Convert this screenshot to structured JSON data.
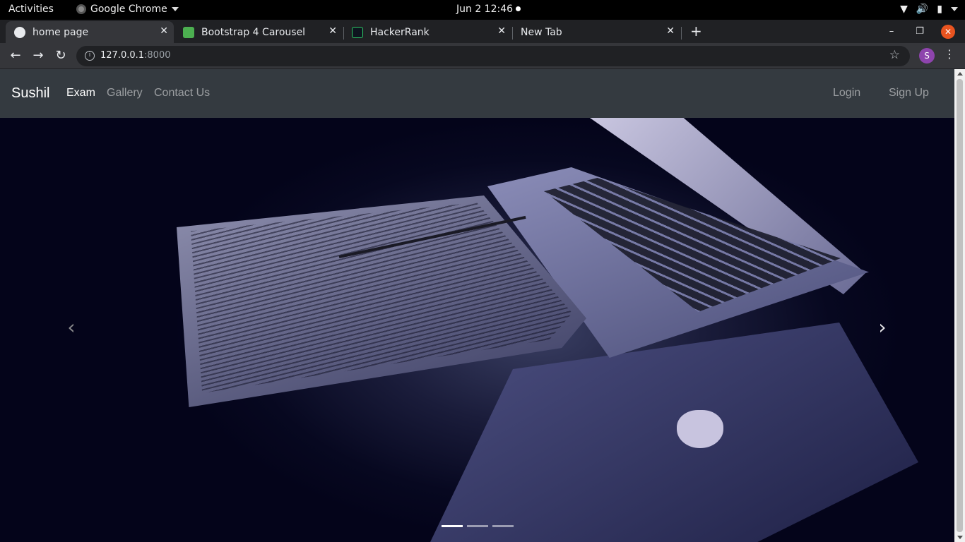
{
  "system_bar": {
    "activities": "Activities",
    "app_name": "Google Chrome",
    "clock": "Jun 2  12:46"
  },
  "browser": {
    "tabs": [
      {
        "title": "home page",
        "favicon": "globe-icon",
        "active": true
      },
      {
        "title": "Bootstrap 4 Carousel",
        "favicon": "w3-icon",
        "active": false
      },
      {
        "title": "HackerRank",
        "favicon": "hackerrank-icon",
        "active": false
      },
      {
        "title": "New Tab",
        "favicon": "",
        "active": false
      }
    ],
    "address": {
      "host": "127.0.0.1",
      "port": ":8000"
    },
    "profile_initial": "S"
  },
  "navbar": {
    "brand": "Sushil",
    "links": [
      "Exam",
      "Gallery",
      "Contact Us"
    ],
    "right_links": [
      "Login",
      "Sign Up"
    ],
    "active_link": "Exam"
  },
  "carousel": {
    "slide_count": 3,
    "active_index": 0,
    "prev_glyph": "‹",
    "next_glyph": "›"
  },
  "colors": {
    "navbar_bg": "#343a40",
    "chrome_bg": "#202124",
    "ubuntu_close": "#e95420"
  }
}
